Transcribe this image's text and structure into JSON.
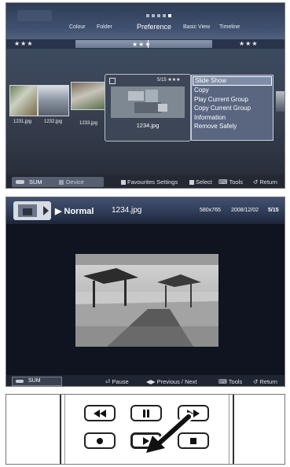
{
  "browser": {
    "tabs": [
      {
        "label": "Colour"
      },
      {
        "label": "Folder"
      },
      {
        "label": "Preference"
      },
      {
        "label": "Basic View"
      },
      {
        "label": "Timeline"
      }
    ],
    "rating_left": "★★★",
    "rating_mid": "★★★",
    "rating_right": "★★★",
    "thumbnails": [
      "1231.jpg",
      "1232.jpg",
      "1233.jpg"
    ],
    "selected_card": {
      "counter": "5/15",
      "stars": "★★★",
      "filename": "1234.jpg"
    },
    "context_menu": [
      "Slide Show",
      "Copy",
      "Play Current Group",
      "Copy Current Group",
      "Information",
      "Remove Safely"
    ],
    "footer": {
      "sum": "SUM",
      "device": "Device",
      "favourites": "Favourites Settings",
      "select": "Select",
      "tools": "Tools",
      "return": "Return"
    }
  },
  "viewer": {
    "mode": "Normal",
    "filename": "1234.jpg",
    "resolution": "580x765",
    "date": "2008/12/02",
    "counter": "5/15",
    "footer": {
      "sum": "SUM",
      "pause": "Pause",
      "prev_next": "Previous / Next",
      "tools": "Tools",
      "return": "Return"
    }
  },
  "remote": {
    "buttons": [
      "rewind-icon",
      "pause-icon",
      "fast-forward-icon",
      "record-icon",
      "play-icon",
      "stop-icon"
    ]
  },
  "colors": {
    "menu_bg": "#5a6680",
    "menu_highlight": "#7e8ca8",
    "bar_dark": "#232833",
    "screen_dark": "#0f1420"
  }
}
